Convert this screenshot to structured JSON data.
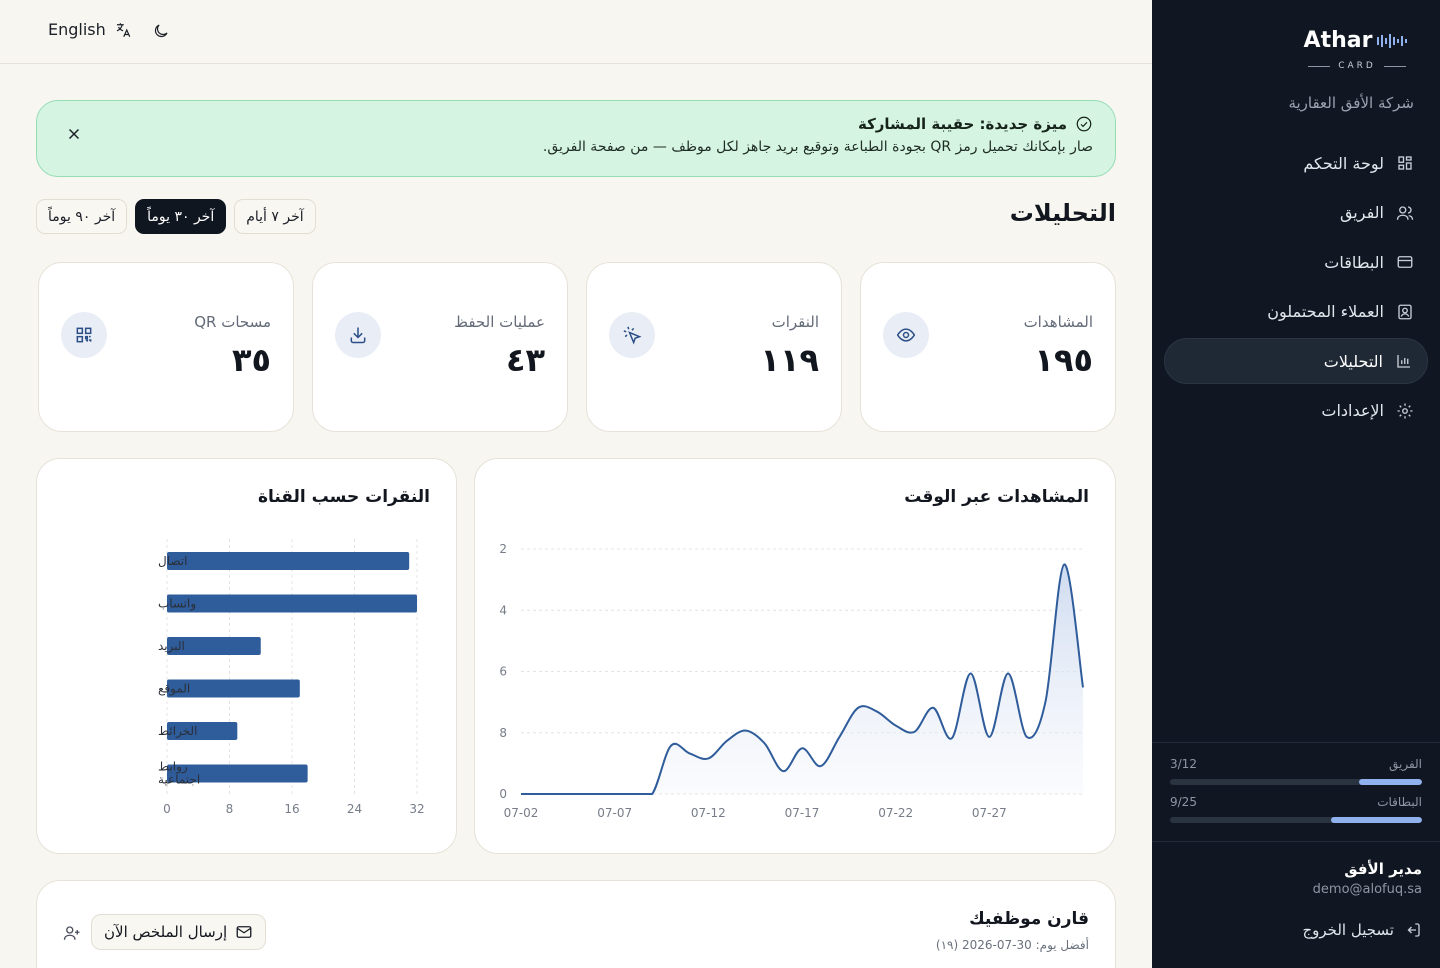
{
  "topbar": {
    "language_label": "English"
  },
  "sidebar": {
    "brand": "Athar",
    "brand_sub": "CARD",
    "company": "شركة الأفق العقارية",
    "items": [
      {
        "label": "لوحة التحكم",
        "icon": "dashboard-icon"
      },
      {
        "label": "الفريق",
        "icon": "team-icon"
      },
      {
        "label": "البطاقات",
        "icon": "card-icon"
      },
      {
        "label": "العملاء المحتملون",
        "icon": "leads-icon"
      },
      {
        "label": "التحليلات",
        "icon": "analytics-icon",
        "active": true
      },
      {
        "label": "الإعدادات",
        "icon": "settings-icon"
      }
    ],
    "usage": [
      {
        "label": "الفريق",
        "value": "3/12",
        "fraction": 0.25
      },
      {
        "label": "البطاقات",
        "value": "9/25",
        "fraction": 0.36
      }
    ],
    "user": {
      "name": "مدير الأفق",
      "email": "demo@alofuq.sa",
      "logout": "تسجيل الخروج"
    }
  },
  "banner": {
    "title": "ميزة جديدة: حقيبة المشاركة",
    "text": "صار بإمكانك تحميل رمز QR بجودة الطباعة وتوقيع بريد جاهز لكل موظف — من صفحة الفريق."
  },
  "page": {
    "title": "التحليلات",
    "ranges": [
      {
        "label": "آخر ٧ أيام",
        "active": false
      },
      {
        "label": "آخر ٣٠ يوماً",
        "active": true
      },
      {
        "label": "آخر ٩٠ يوماً",
        "active": false
      }
    ]
  },
  "stats": [
    {
      "label": "المشاهدات",
      "value": "١٩٥",
      "icon": "eye-icon"
    },
    {
      "label": "النقرات",
      "value": "١١٩",
      "icon": "click-icon"
    },
    {
      "label": "عمليات الحفظ",
      "value": "٤٣",
      "icon": "download-icon"
    },
    {
      "label": "مسحات QR",
      "value": "٣٥",
      "icon": "qr-icon"
    }
  ],
  "chart_data": [
    {
      "type": "area",
      "title": "المشاهدات عبر الوقت",
      "x_ticks": [
        "07-02",
        "07-07",
        "07-12",
        "07-17",
        "07-22",
        "07-27"
      ],
      "y_ticks": [
        "0",
        "8",
        "6",
        "4",
        "2"
      ],
      "x": [
        "07-02",
        "07-03",
        "07-04",
        "07-05",
        "07-06",
        "07-07",
        "07-08",
        "07-09",
        "07-10",
        "07-11",
        "07-12",
        "07-13",
        "07-14",
        "07-15",
        "07-16",
        "07-17",
        "07-18",
        "07-19",
        "07-20",
        "07-21",
        "07-22",
        "07-23",
        "07-24",
        "07-25",
        "07-26",
        "07-27",
        "07-28",
        "07-29",
        "07-30",
        "07-31"
      ],
      "values": [
        0,
        0,
        0,
        0,
        0,
        0,
        0,
        0,
        3.8,
        3.2,
        2.8,
        4.2,
        5,
        4,
        1.8,
        3.6,
        2.2,
        4.5,
        6.8,
        6.5,
        5.4,
        4.9,
        6.8,
        4.4,
        9.5,
        4.5,
        9.5,
        4.5,
        7.3,
        18.1,
        8.4
      ],
      "color": "#2f5c9a"
    },
    {
      "type": "bar",
      "orientation": "horizontal",
      "title": "النقرات حسب القناة",
      "categories": [
        "اتصال",
        "واتساب",
        "البريد",
        "الموقع",
        "الخرائط",
        "روابط اجتماعية"
      ],
      "values": [
        31,
        32,
        12,
        17,
        9,
        18
      ],
      "x_ticks": [
        "0",
        "8",
        "16",
        "24",
        "32"
      ],
      "xlim": [
        0,
        32
      ],
      "color": "#2f5c9a"
    }
  ],
  "compare": {
    "title": "قارن موظفيك",
    "subtitle": "أفضل يوم: 30-07-2026 (١٩)",
    "send_label": "إرسال الملخص الآن"
  }
}
